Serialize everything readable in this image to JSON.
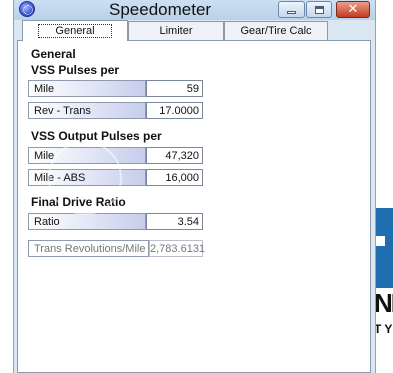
{
  "window": {
    "title": "Speedometer",
    "icon": "speedometer-app-icon"
  },
  "titlebar_buttons": {
    "minimize_icon": "minimize-icon",
    "maximize_icon": "maximize-icon",
    "close_icon": "close-icon",
    "close_glyph": "✕",
    "close_color": "#c43a1f"
  },
  "tabs": [
    {
      "label": "General",
      "active": true
    },
    {
      "label": "Limiter",
      "active": false
    },
    {
      "label": "Gear/Tire Calc",
      "active": false
    }
  ],
  "general": {
    "heading": "General",
    "vss_pulses": {
      "heading": "VSS Pulses per",
      "rows": [
        {
          "label": "Mile",
          "value": "59"
        },
        {
          "label": "Rev - Trans",
          "value": "17.0000"
        }
      ]
    },
    "vss_output": {
      "heading": "VSS Output Pulses per",
      "rows": [
        {
          "label": "Mile",
          "value": "47,320"
        },
        {
          "label": "Mile - ABS",
          "value": "16,000"
        }
      ]
    },
    "final_drive": {
      "heading": "Final Drive Ratio",
      "rows": [
        {
          "label": "Ratio",
          "value": "3.54"
        }
      ]
    },
    "trans_revolutions": {
      "label": "Trans Revolutions/Mile",
      "value": "2,783.6131"
    }
  },
  "background": {
    "fragment_1": "NI",
    "fragment_2": "TY",
    "accent": "#1f6fb0"
  }
}
